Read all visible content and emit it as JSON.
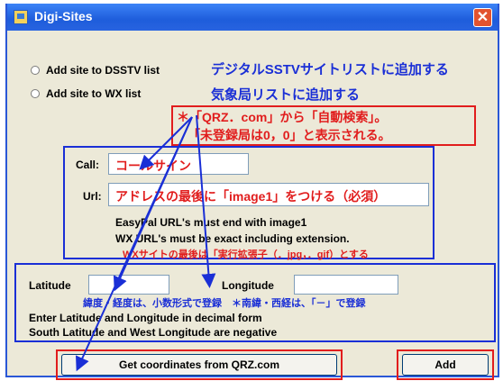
{
  "window": {
    "title": "Digi-Sites",
    "close_glyph": "✕"
  },
  "options": {
    "dsstv_label": "Add site to DSSTV list",
    "wx_label": "Add site to WX list"
  },
  "annotations": {
    "dsstv_jp": "デジタルSSTVサイトリストに追加する",
    "wx_jp": "気象局リストに追加する",
    "qrz_jp_line1": "＊「QRZ．com」から「自動検索」。",
    "qrz_jp_line2": "「未登録局は0，0」と表示される。",
    "wx_ext_jp": "WXサイトの最後は「実行拡張子（．jpg，．gif）とする",
    "latlon_jp": "緯度・経度は、小数形式で登録　＊南緯・西経は、「－」で登録"
  },
  "form": {
    "call_label": "Call:",
    "call_value": "コールサイン",
    "url_label": "Url:",
    "url_value": "アドレスの最後に「image1」をつける（必須）",
    "easypal_note": "EasyPal URL's must end with image1",
    "wx_note": "WX URL's must be exact including extension.",
    "latitude_label": "Latitude",
    "longitude_label": "Longitude",
    "latlon_note1": "Enter Latitude and Longitude in decimal form",
    "latlon_note2": "South Latitude and West Longitude are negative"
  },
  "buttons": {
    "qrz_label": "Get coordinates from QRZ.com",
    "add_label": "Add"
  },
  "colors": {
    "annotation_red": "#e11d1d",
    "annotation_blue": "#1a2fd6",
    "titlebar": "#2863e0"
  }
}
